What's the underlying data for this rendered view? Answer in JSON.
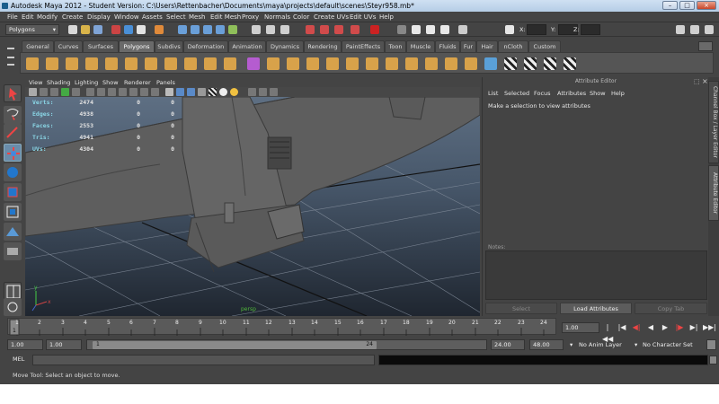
{
  "window": {
    "title": "Autodesk Maya 2012 - Student Version: C:\\Users\\Rettenbacher\\Documents\\maya\\projects\\default\\scenes\\Steyr958.mb*",
    "minimize": "–",
    "maximize": "□",
    "close": "×"
  },
  "menubar": [
    "File",
    "Edit",
    "Modify",
    "Create",
    "Display",
    "Window",
    "Assets",
    "Select",
    "Mesh",
    "Edit Mesh",
    "Proxy",
    "Normals",
    "Color",
    "Create UVs",
    "Edit UVs",
    "Help"
  ],
  "status_line": {
    "menu_set": "Polygons",
    "x_label": "X:",
    "y_label": "Y:",
    "z_label": "Z:"
  },
  "shelf": {
    "tabs": [
      "General",
      "Curves",
      "Surfaces",
      "Polygons",
      "Subdivs",
      "Deformation",
      "Animation",
      "Dynamics",
      "Rendering",
      "PaintEffects",
      "Toon",
      "Muscle",
      "Fluids",
      "Fur",
      "Hair",
      "nCloth",
      "Custom"
    ],
    "active_tab": "Polygons"
  },
  "viewport": {
    "menus": [
      "View",
      "Shading",
      "Lighting",
      "Show",
      "Renderer",
      "Panels"
    ],
    "hud": [
      {
        "label": "Verts:",
        "a": "2474",
        "b": "0",
        "c": "0"
      },
      {
        "label": "Edges:",
        "a": "4938",
        "b": "0",
        "c": "0"
      },
      {
        "label": "Faces:",
        "a": "2553",
        "b": "0",
        "c": "0"
      },
      {
        "label": "Tris:",
        "a": "4941",
        "b": "0",
        "c": "0"
      },
      {
        "label": "UVs:",
        "a": "4304",
        "b": "0",
        "c": "0"
      }
    ],
    "camera": "persp"
  },
  "attribute_editor": {
    "title": "Attribute Editor",
    "menus": [
      "List",
      "Selected",
      "Focus",
      "Attributes",
      "Show",
      "Help"
    ],
    "message": "Make a selection to view attributes",
    "notes_label": "Notes:",
    "buttons": {
      "select": "Select",
      "load": "Load Attributes",
      "copy": "Copy Tab"
    }
  },
  "side_tabs": {
    "channel_box": "Channel Box / Layer Editor",
    "attribute_editor": "Attribute Editor"
  },
  "time_slider": {
    "ticks": [
      "1",
      "2",
      "3",
      "4",
      "5",
      "6",
      "7",
      "8",
      "9",
      "10",
      "11",
      "12",
      "13",
      "14",
      "15",
      "16",
      "17",
      "18",
      "19",
      "20",
      "21",
      "22",
      "23",
      "24"
    ],
    "current_time": "1.00",
    "start_marker": "1"
  },
  "playback": [
    "|◀◀",
    "|◀",
    "◀|",
    "◀",
    "▶",
    "|▶",
    "▶|",
    "▶▶|"
  ],
  "range_slider": {
    "start": "1.00",
    "playback_start": "1.00",
    "range_start": "1",
    "range_end": "24",
    "playback_end": "24.00",
    "end": "48.00",
    "anim_layer": "No Anim Layer",
    "character_set": "No Character Set"
  },
  "command_line": {
    "label": "MEL"
  },
  "help_line": "Move Tool: Select an object to move.",
  "colors": {
    "bg": "#444444",
    "hud_label": "#8ad6e6",
    "camera_label": "#50b83a"
  }
}
